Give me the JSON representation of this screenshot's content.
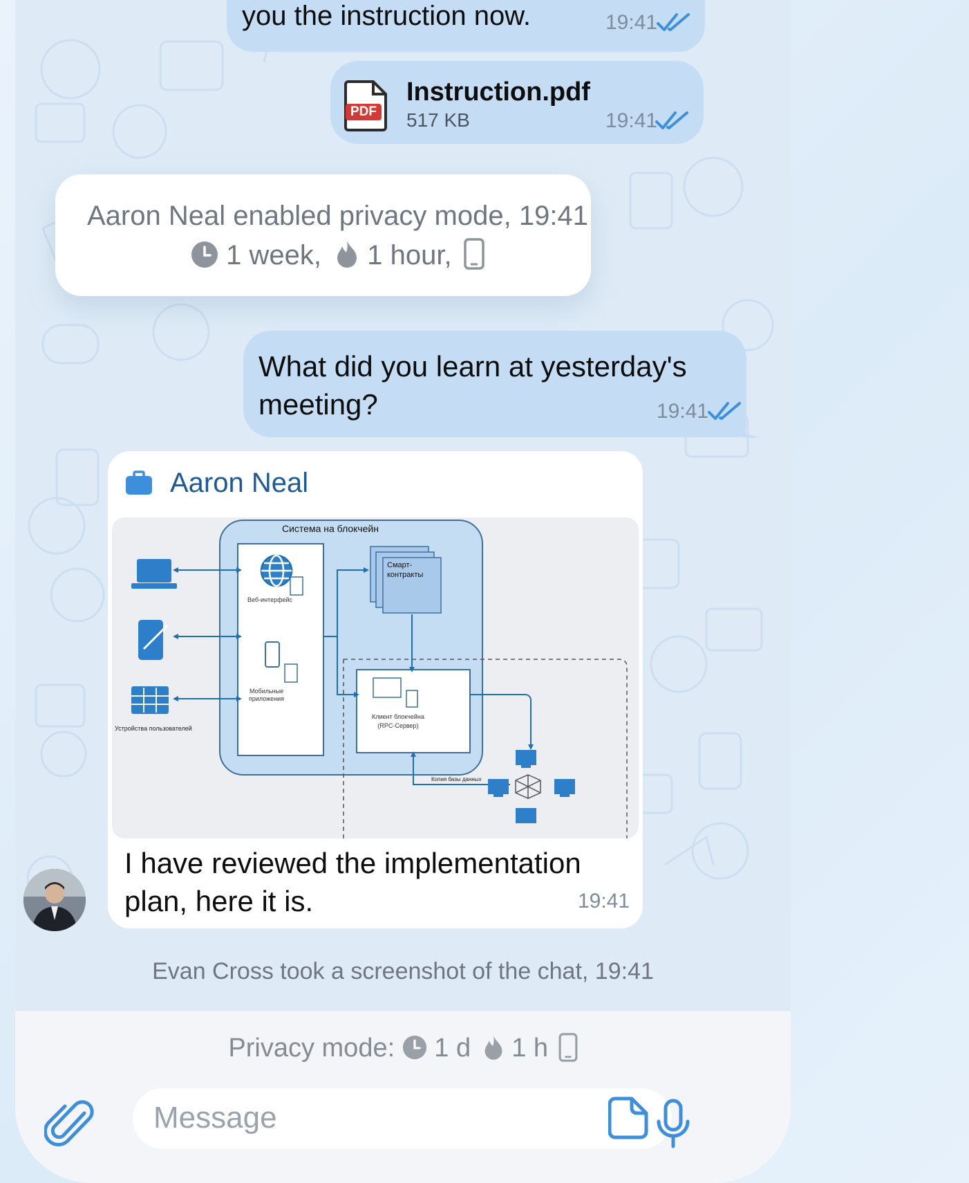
{
  "messages": {
    "m1": {
      "text": "you the instruction now.",
      "time": "19:41"
    },
    "file": {
      "badge": "PDF",
      "name": "Instruction.pdf",
      "size": "517 KB",
      "time": "19:41"
    },
    "service1": {
      "line1": "Aaron Neal enabled privacy mode,",
      "time": "19:41",
      "week": "1 week,",
      "hour": "1 hour,"
    },
    "m2": {
      "line1": "What did you learn at yesterday's",
      "line2": "meeting?",
      "time": "19:41"
    },
    "incoming": {
      "sender": "Aaron Neal",
      "line1": "I have reviewed the implementation",
      "line2": "plan, here it is.",
      "time": "19:41",
      "diagram": {
        "title": "Система на блокчейн",
        "smart": [
          "Смарт-",
          "контракты"
        ],
        "web": "Веб-интерфейс",
        "mobile": [
          "Мобильные",
          "приложения"
        ],
        "devices": "Устройства пользователей",
        "client": [
          "Клиент блокчейна",
          "(RPC-Сервер)"
        ],
        "db_copy": "Копия базы данных"
      }
    },
    "service2": {
      "text": "Evan Cross took a screenshot of the chat,",
      "time": "19:41"
    }
  },
  "privacy_bar": {
    "label": "Privacy mode:",
    "day": "1 d",
    "hour": "1 h"
  },
  "composer": {
    "placeholder": "Message"
  },
  "colors": {
    "accent": "#3d8fdb",
    "bubble_out": "#c4ddf5",
    "sender": "#1d5a96"
  }
}
